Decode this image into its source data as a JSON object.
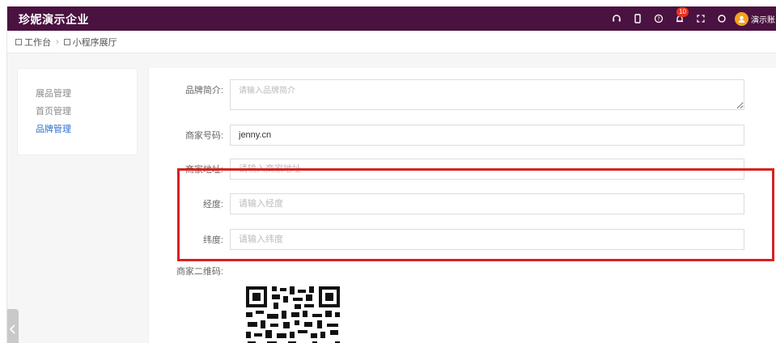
{
  "header": {
    "title": "珍妮演示企业",
    "notification_count": "10",
    "username": "演示账"
  },
  "breadcrumb": {
    "items": [
      "工作台",
      "小程序展厅"
    ]
  },
  "sidebar": {
    "items": [
      {
        "label": "展品管理"
      },
      {
        "label": "首页管理"
      },
      {
        "label": "品牌管理"
      }
    ],
    "active_index": 2
  },
  "form": {
    "brand_intro": {
      "label": "品牌简介:",
      "placeholder": "请输入品牌简介",
      "value": ""
    },
    "merchant_code": {
      "label": "商家号码:",
      "value": "jenny.cn"
    },
    "merchant_address": {
      "label": "商家地址:",
      "placeholder": "请输入商家地址",
      "value": ""
    },
    "longitude": {
      "label": "经度:",
      "placeholder": "请输入经度",
      "value": ""
    },
    "latitude": {
      "label": "纬度:",
      "placeholder": "请输入纬度",
      "value": ""
    },
    "qr_code": {
      "label": "商家二维码:"
    }
  },
  "colors": {
    "header_bg": "#4a1240",
    "active_link": "#2b6fcf",
    "highlight": "#d62121",
    "badge": "#e8321f",
    "avatar": "#f4a21c"
  },
  "icons": [
    "headset-icon",
    "mobile-icon",
    "help-icon",
    "bell-icon",
    "fullscreen-icon",
    "refresh-icon",
    "user-avatar-icon",
    "collapse-left-icon"
  ]
}
